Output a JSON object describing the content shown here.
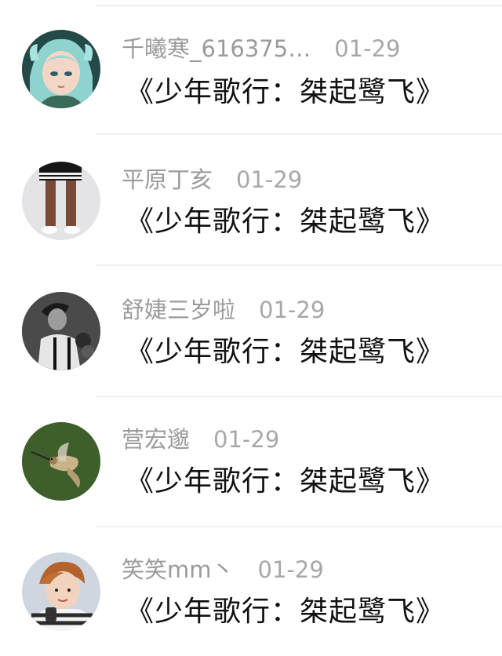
{
  "comments": [
    {
      "user": "千曦寒_616375…",
      "date": "01-29",
      "text": "《少年歌行：桀起鹭飞》",
      "avatar": "anime-girl-avatar"
    },
    {
      "user": "平原丁亥",
      "date": "01-29",
      "text": "《少年歌行：桀起鹭飞》",
      "avatar": "legs-shorts-avatar"
    },
    {
      "user": "舒婕三岁啦",
      "date": "01-29",
      "text": "《少年歌行：桀起鹭飞》",
      "avatar": "bw-man-avatar"
    },
    {
      "user": "营宏邈",
      "date": "01-29",
      "text": "《少年歌行：桀起鹭飞》",
      "avatar": "hummingbird-avatar"
    },
    {
      "user": "笑笑mm丶",
      "date": "01-29",
      "text": "《少年歌行：桀起鹭飞》",
      "avatar": "boy-selfie-avatar"
    }
  ]
}
